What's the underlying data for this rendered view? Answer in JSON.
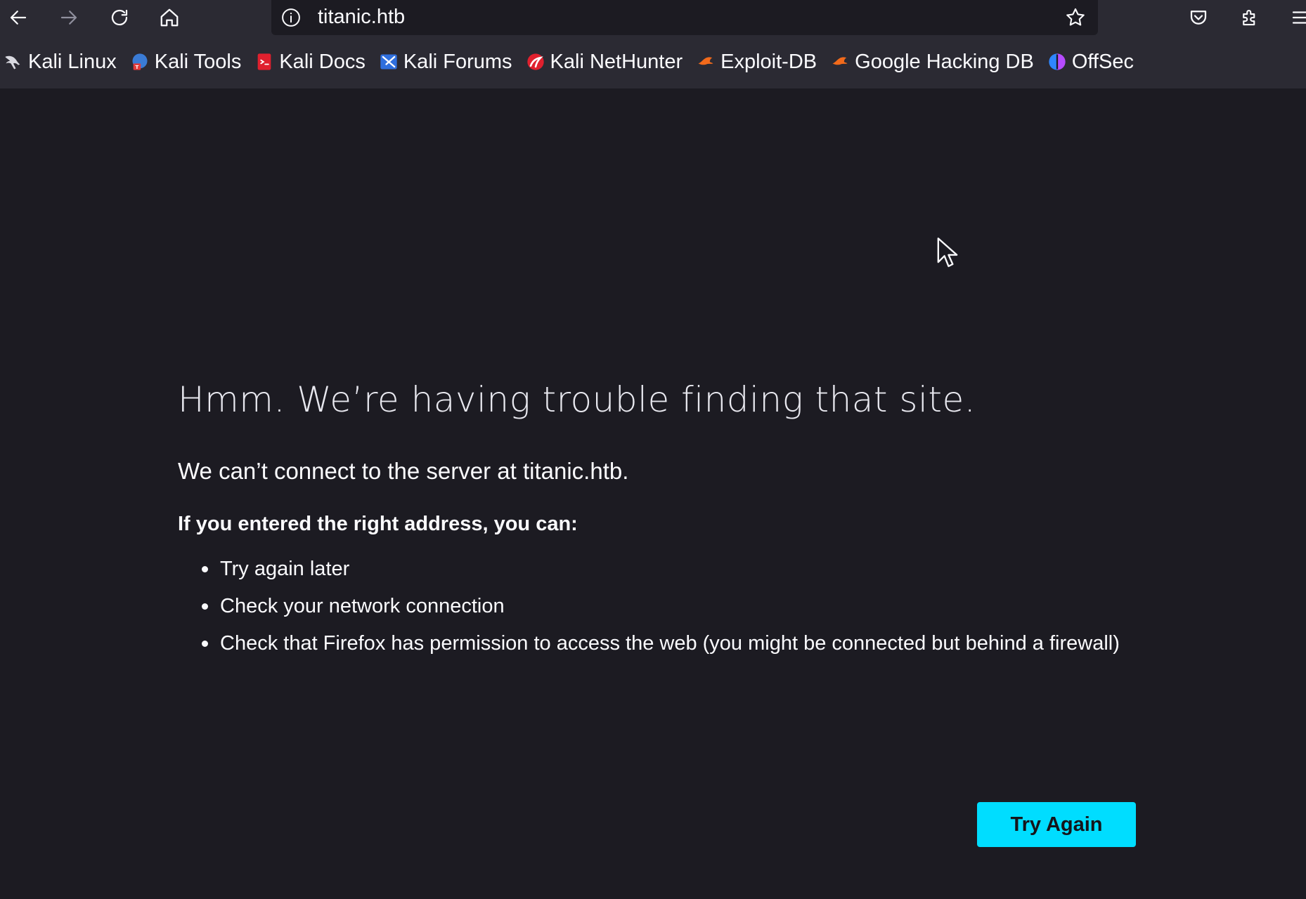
{
  "browser": {
    "url": "titanic.htb",
    "toolbar": {
      "back": "back-arrow-icon",
      "forward": "forward-arrow-icon",
      "reload": "reload-icon",
      "home": "home-icon",
      "info": "info-icon",
      "bookmark_star": "star-icon",
      "pocket": "pocket-icon",
      "extensions": "extensions-icon",
      "menu": "hamburger-menu-icon"
    },
    "bookmarks": [
      {
        "label": "Kali Linux",
        "icon": "kali-dragon-icon"
      },
      {
        "label": "Kali Tools",
        "icon": "kali-tools-icon"
      },
      {
        "label": "Kali Docs",
        "icon": "kali-docs-icon"
      },
      {
        "label": "Kali Forums",
        "icon": "kali-forums-icon"
      },
      {
        "label": "Kali NetHunter",
        "icon": "kali-nethunter-icon"
      },
      {
        "label": "Exploit-DB",
        "icon": "exploit-db-icon"
      },
      {
        "label": "Google Hacking DB",
        "icon": "ghdb-icon"
      },
      {
        "label": "OffSec",
        "icon": "offsec-icon"
      }
    ]
  },
  "error_page": {
    "title": "Hmm. We’re having trouble finding that site.",
    "description": "We can’t connect to the server at titanic.htb.",
    "subheading": "If you entered the right address, you can:",
    "suggestions": [
      "Try again later",
      "Check your network connection",
      "Check that Firefox has permission to access the web (you might be connected but behind a firewall)"
    ],
    "try_again_label": "Try Again"
  },
  "colors": {
    "page_background": "#1c1b22",
    "chrome_background": "#2b2a33",
    "accent_button": "#00ddff",
    "text": "#fbfbfe"
  }
}
